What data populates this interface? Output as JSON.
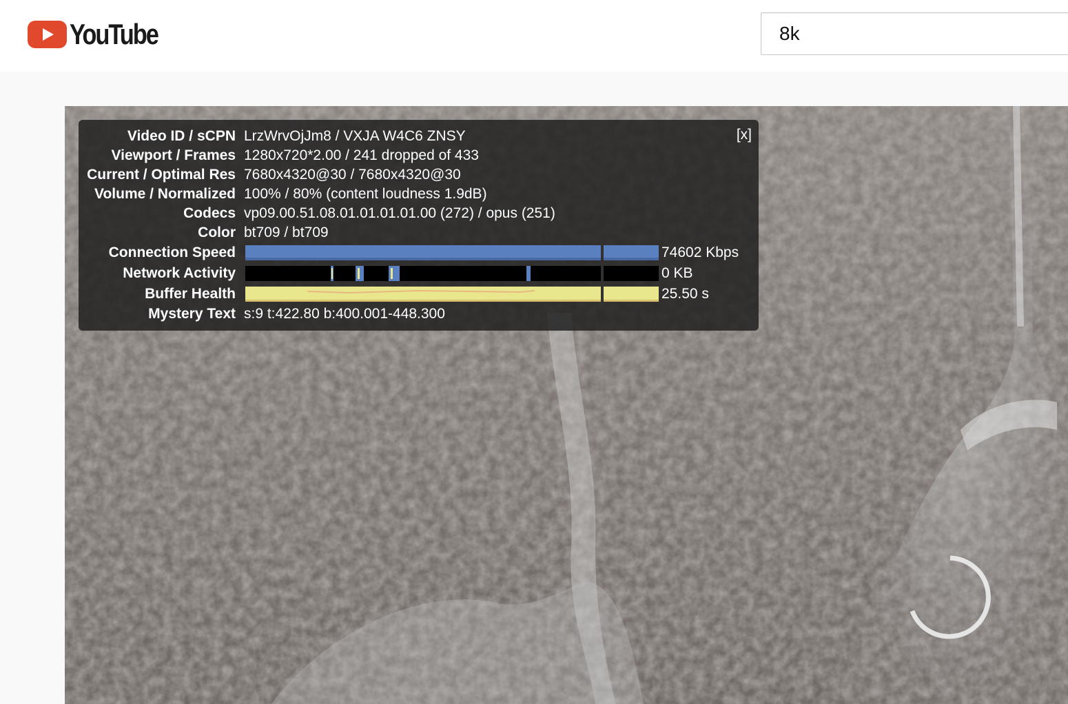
{
  "header": {
    "logo_text": "YouTube",
    "search_value": "8k"
  },
  "stats": {
    "close_label": "[x]",
    "rows": [
      {
        "label": "Video ID / sCPN",
        "value": "LrzWrvOjJm8 / VXJA W4C6 ZNSY"
      },
      {
        "label": "Viewport / Frames",
        "value": "1280x720*2.00 / 241 dropped of 433"
      },
      {
        "label": "Current / Optimal Res",
        "value": "7680x4320@30 / 7680x4320@30"
      },
      {
        "label": "Volume / Normalized",
        "value": "100% / 80% (content loudness 1.9dB)"
      },
      {
        "label": "Codecs",
        "value": "vp09.00.51.08.01.01.01.01.00 (272) / opus (251)"
      },
      {
        "label": "Color",
        "value": "bt709 / bt709"
      }
    ],
    "connection_speed": {
      "label": "Connection Speed",
      "value": "74602 Kbps",
      "color": "#5b80c0"
    },
    "network_activity": {
      "label": "Network Activity",
      "value": "0 KB",
      "color": "#000000"
    },
    "buffer_health": {
      "label": "Buffer Health",
      "value": "25.50 s",
      "color": "#e8e78e"
    },
    "mystery": {
      "label": "Mystery Text",
      "value": "s:9 t:422.80 b:400.001-448.300"
    }
  },
  "colors": {
    "brand_red": "#e0492b",
    "overlay_bg": "#1c1c1c"
  }
}
